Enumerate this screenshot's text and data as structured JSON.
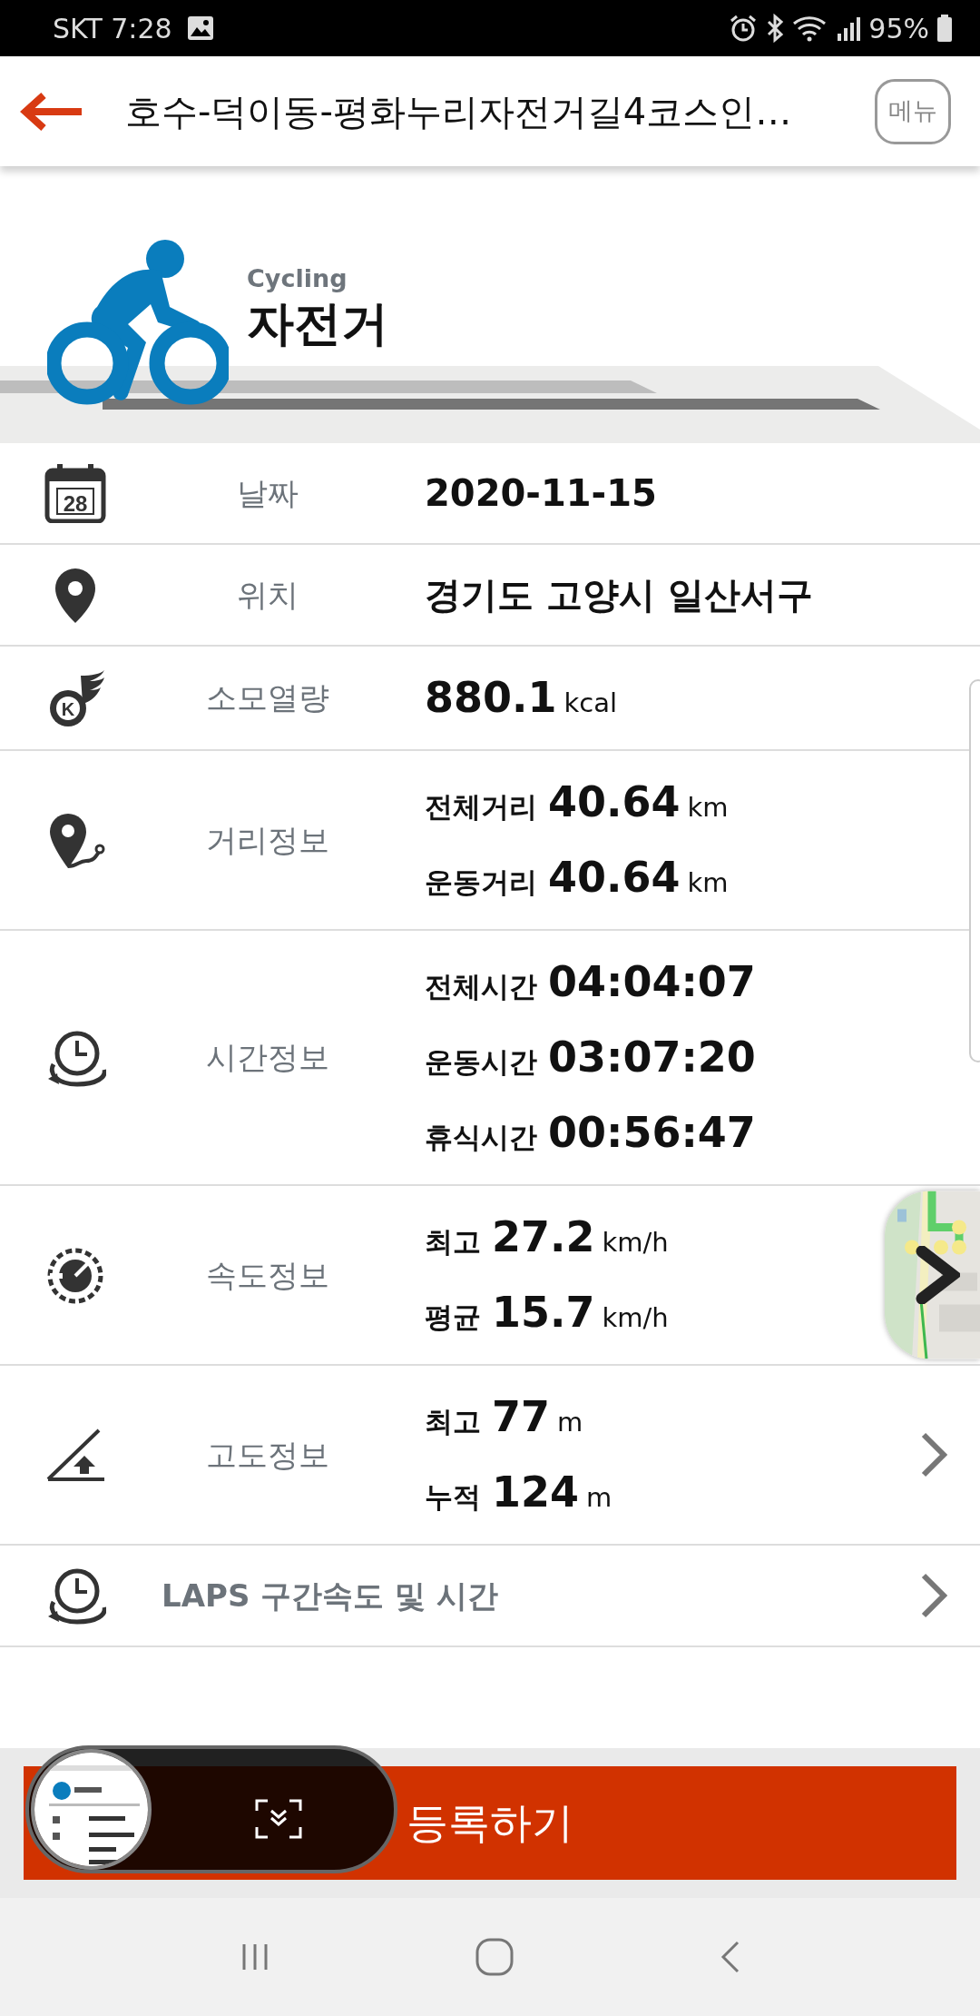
{
  "status_bar": {
    "carrier_time": "SKT 7:28",
    "battery": "95%"
  },
  "header": {
    "title": "호수-덕이동-평화누리자전거길4코스인…",
    "menu_button": "메뉴"
  },
  "activity": {
    "subtitle": "Cycling",
    "title": "자전거"
  },
  "rows": [
    {
      "kind": "calendar",
      "icon_text": "28",
      "label": "날짜",
      "chevron": false,
      "map": false,
      "lines": [
        {
          "number": "2020-11-15"
        }
      ]
    },
    {
      "kind": "pin",
      "label": "위치",
      "chevron": false,
      "map": false,
      "lines": [
        {
          "number": "경기도 고양시 일산서구"
        }
      ]
    },
    {
      "kind": "calorie",
      "icon_text": "K",
      "label": "소모열량",
      "chevron": false,
      "map": false,
      "lines": [
        {
          "number": "880.1",
          "unit": "kcal"
        }
      ]
    },
    {
      "kind": "route",
      "label": "거리정보",
      "chevron": false,
      "map": false,
      "lines": [
        {
          "prefix": "전체거리",
          "number": "40.64",
          "unit": "km"
        },
        {
          "prefix": "운동거리",
          "number": "40.64",
          "unit": "km"
        }
      ]
    },
    {
      "kind": "clock",
      "label": "시간정보",
      "chevron": false,
      "map": false,
      "lines": [
        {
          "prefix": "전체시간",
          "number": "04:04:07"
        },
        {
          "prefix": "운동시간",
          "number": "03:07:20"
        },
        {
          "prefix": "휴식시간",
          "number": "00:56:47"
        }
      ]
    },
    {
      "kind": "speed",
      "label": "속도정보",
      "chevron": false,
      "map": true,
      "lines": [
        {
          "prefix": "최고",
          "number": "27.2",
          "unit": "km/h"
        },
        {
          "prefix": "평균",
          "number": "15.7",
          "unit": "km/h"
        }
      ]
    },
    {
      "kind": "slope",
      "label": "고도정보",
      "chevron": true,
      "map": false,
      "lines": [
        {
          "prefix": "최고",
          "number": "77",
          "unit": "m"
        },
        {
          "prefix": "누적",
          "number": "124",
          "unit": "m"
        }
      ]
    },
    {
      "kind": "laps",
      "label": "LAPS 구간속도 및 시간",
      "chevron": true,
      "map": false
    }
  ],
  "register_button": "등록하기"
}
